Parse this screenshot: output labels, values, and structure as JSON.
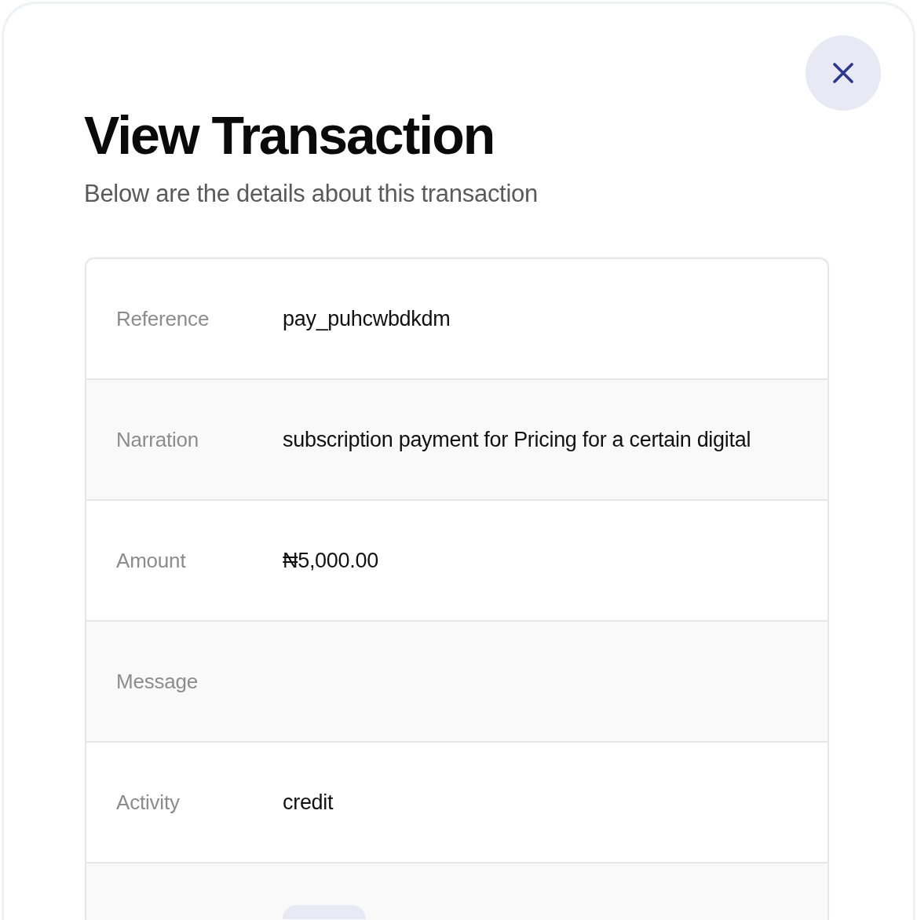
{
  "modal": {
    "title": "View Transaction",
    "subtitle": "Below are the details about this transaction"
  },
  "details": {
    "rows": [
      {
        "kind": "text",
        "label": "Reference",
        "value": "pay_puhcwbdkdm"
      },
      {
        "kind": "text",
        "label": "Narration",
        "value": "subscription payment for Pricing for a certain digital"
      },
      {
        "kind": "text",
        "label": "Amount",
        "value": "₦5,000.00"
      },
      {
        "kind": "text",
        "label": "Message"
      },
      {
        "kind": "text",
        "label": "Activity",
        "value": "credit"
      },
      {
        "kind": "badge"
      }
    ]
  }
}
